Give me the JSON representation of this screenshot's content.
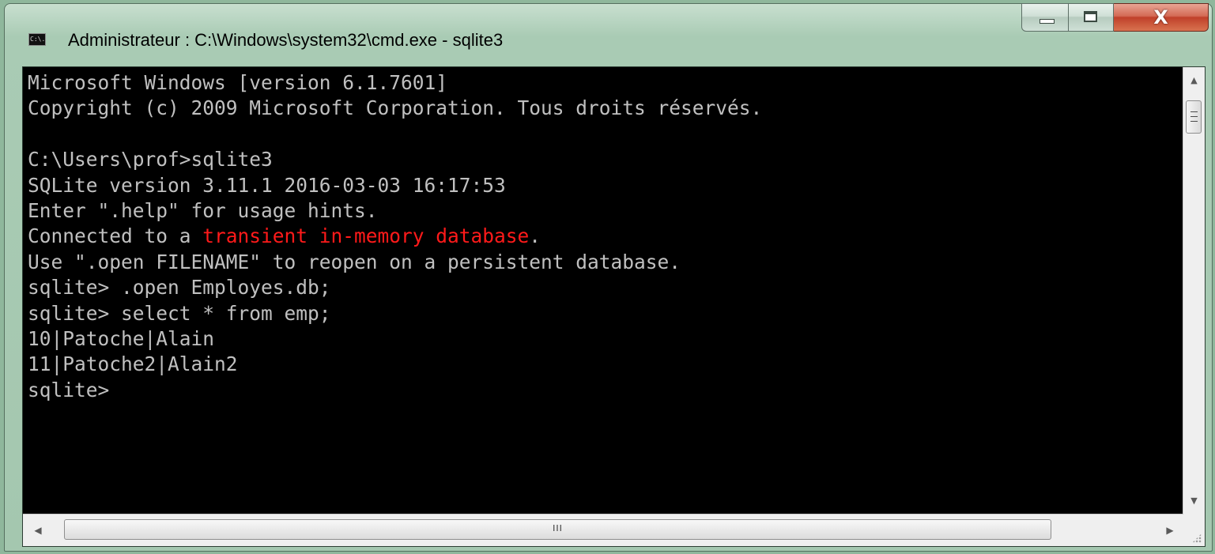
{
  "window": {
    "title": "Administrateur : C:\\Windows\\system32\\cmd.exe - sqlite3",
    "app_icon": "cmd-console-icon",
    "app_icon_text": "C:\\.",
    "buttons": {
      "minimize_icon": "minimize-icon",
      "maximize_icon": "maximize-icon",
      "close_icon": "close-icon",
      "close_label": "X"
    }
  },
  "console": {
    "lines": [
      {
        "text": "Microsoft Windows [version 6.1.7601]"
      },
      {
        "text": "Copyright (c) 2009 Microsoft Corporation. Tous droits réservés."
      },
      {
        "text": ""
      },
      {
        "text": "C:\\Users\\prof>sqlite3"
      },
      {
        "text": "SQLite version 3.11.1 2016-03-03 16:17:53"
      },
      {
        "text": "Enter \".help\" for usage hints."
      },
      {
        "pre": "Connected to a ",
        "highlight": "transient in-memory database",
        "post": "."
      },
      {
        "text": "Use \".open FILENAME\" to reopen on a persistent database."
      },
      {
        "text": "sqlite> .open Employes.db;"
      },
      {
        "text": "sqlite> select * from emp;"
      },
      {
        "text": "10|Patoche|Alain"
      },
      {
        "text": "11|Patoche2|Alain2"
      },
      {
        "text": "sqlite>"
      }
    ]
  },
  "scrollbars": {
    "vertical": {
      "up_icon": "▲",
      "down_icon": "▼"
    },
    "horizontal": {
      "left_icon": "◀",
      "right_icon": "▶",
      "thumb_grip": "III"
    }
  },
  "colors": {
    "console_bg": "#000000",
    "console_text": "#c0c0c0",
    "highlight": "#ff1a1a",
    "frame": "#a4c7af"
  }
}
